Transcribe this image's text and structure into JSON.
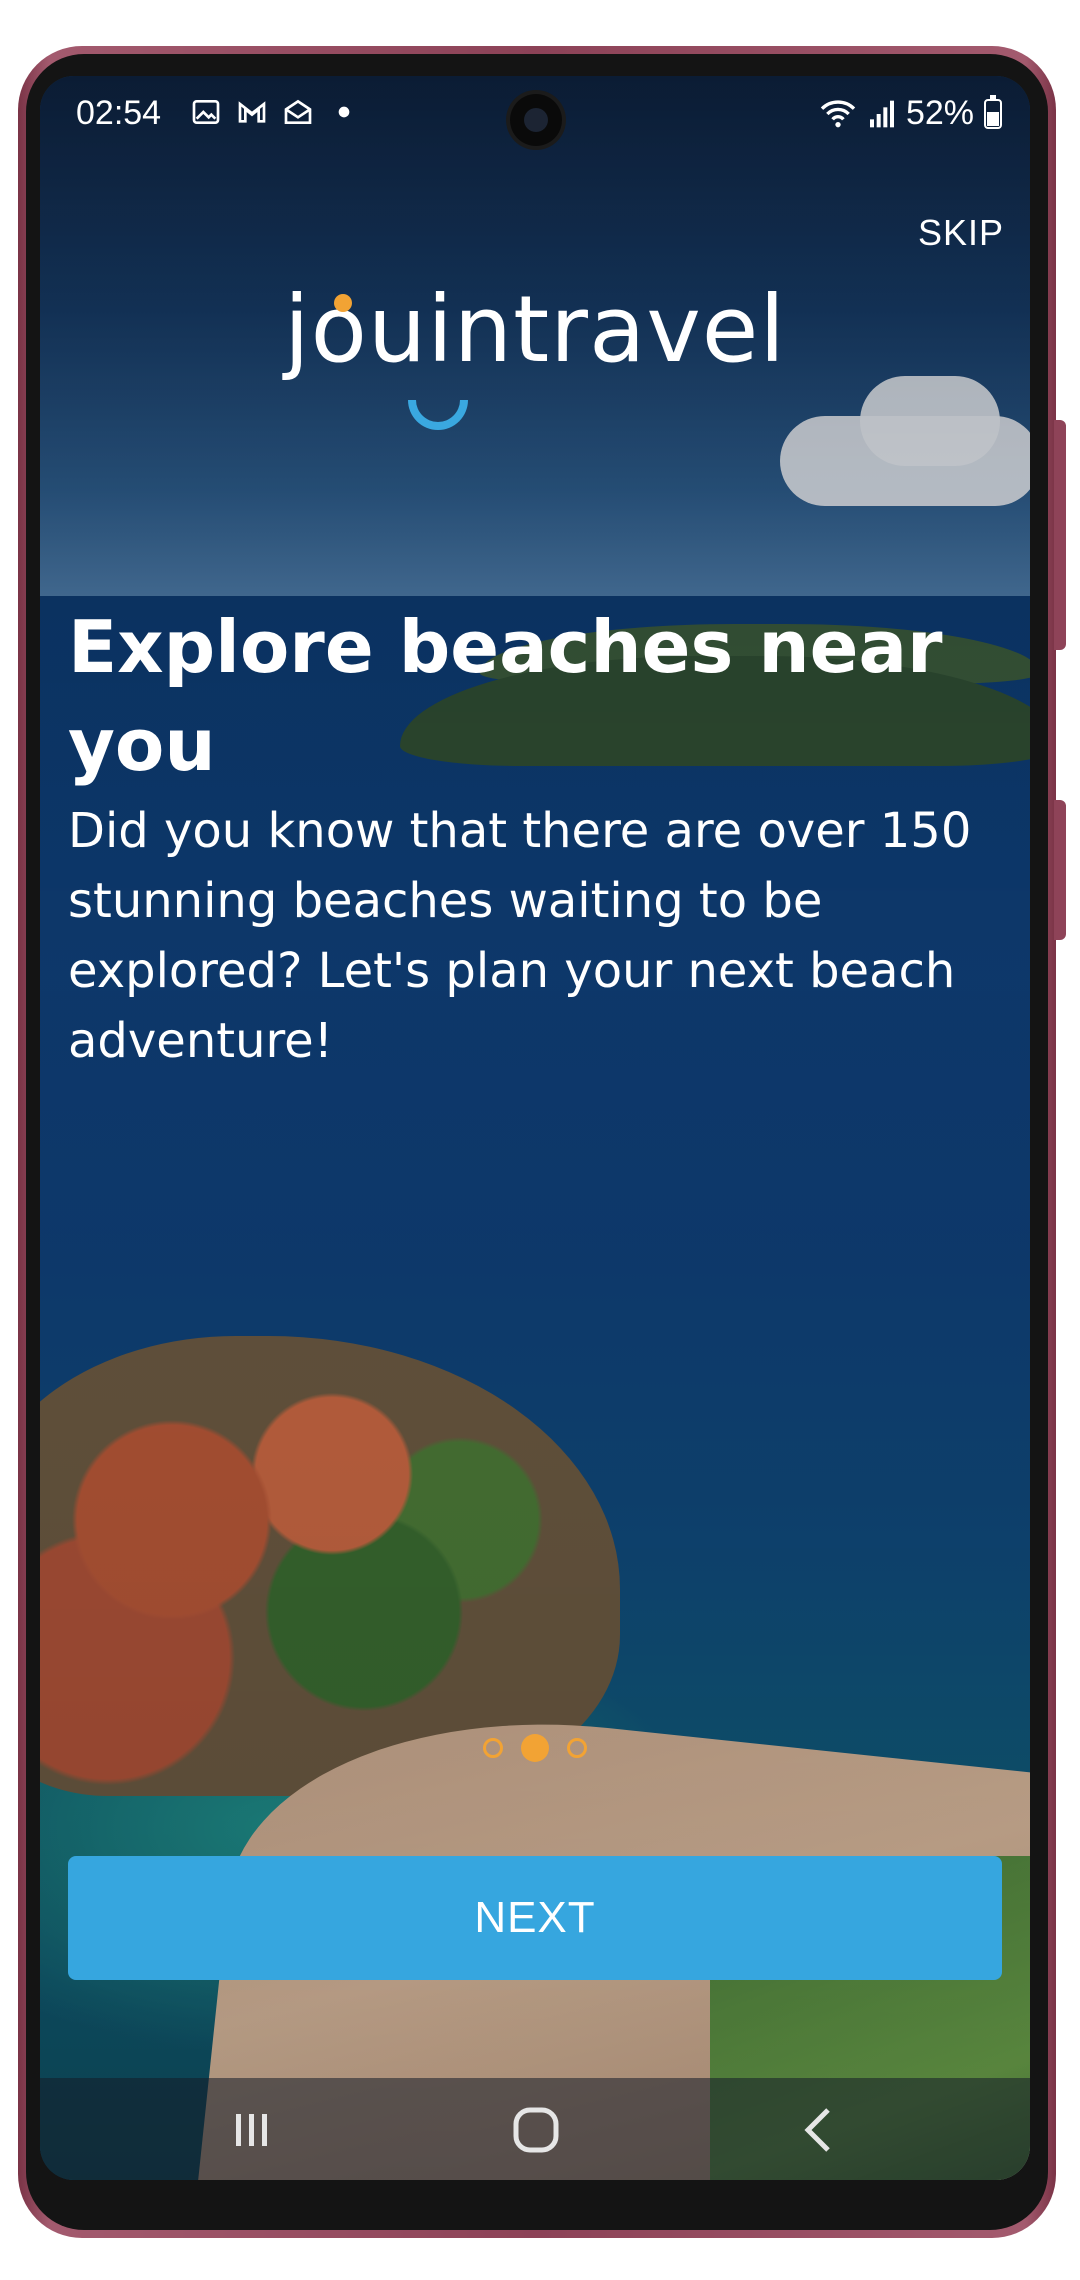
{
  "status_bar": {
    "time": "02:54",
    "battery": "52%",
    "battery_level": 0.52,
    "left_icons": [
      "image-icon",
      "gmail-icon",
      "mail-open-icon",
      "dot-icon"
    ],
    "right_icons": [
      "wifi-icon",
      "signal-icon",
      "battery-icon"
    ]
  },
  "header": {
    "skip_label": "SKIP",
    "logo_text": "jouintravel"
  },
  "content": {
    "headline": "Explore beaches near you",
    "body": "Did you know that there are over 150 stunning beaches waiting to be explored? Let's plan your next beach adventure!"
  },
  "pager": {
    "count": 3,
    "active_index": 1
  },
  "actions": {
    "next_label": "NEXT"
  },
  "colors": {
    "accent_blue": "#36a6df",
    "accent_orange": "#f2a334"
  },
  "nav_bar": {
    "items": [
      "recent-apps-icon",
      "home-icon",
      "back-icon"
    ]
  }
}
